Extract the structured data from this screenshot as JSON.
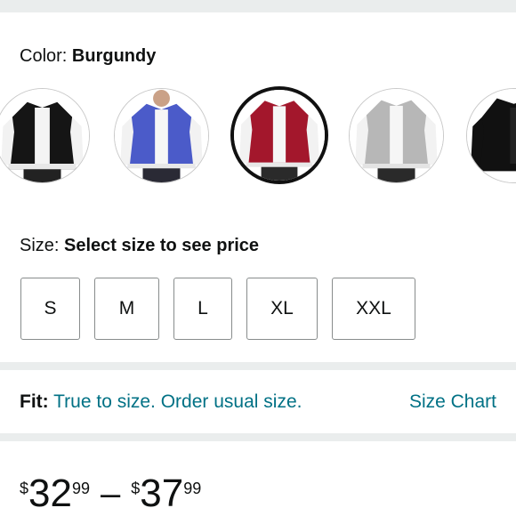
{
  "color": {
    "label": "Color:",
    "value": "Burgundy"
  },
  "swatches": [
    {
      "name": "Black",
      "body": "#151515",
      "sleeve": "#f2f2f2"
    },
    {
      "name": "Blue",
      "body": "#4b5bc9",
      "sleeve": "#f2f2f2"
    },
    {
      "name": "Burgundy",
      "body": "#a3172c",
      "sleeve": "#f2f2f2",
      "selected": true
    },
    {
      "name": "Gray",
      "body": "#b7b7b7",
      "sleeve": "#f2f2f2"
    },
    {
      "name": "Black Hooded",
      "body": "#111111",
      "sleeve": "#111111"
    }
  ],
  "size": {
    "label": "Size:",
    "prompt": "Select size to see price",
    "options": [
      "S",
      "M",
      "L",
      "XL",
      "XXL"
    ]
  },
  "fit": {
    "label": "Fit:",
    "text": "True to size. Order usual size.",
    "chart_link": "Size Chart"
  },
  "price": {
    "currency": "$",
    "low_whole": "32",
    "low_frac": "99",
    "separator": "–",
    "high_whole": "37",
    "high_frac": "99"
  }
}
